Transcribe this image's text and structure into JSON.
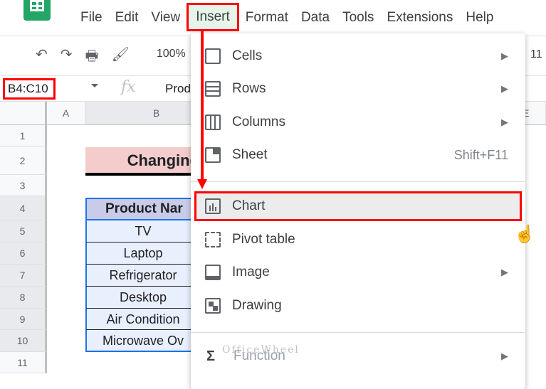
{
  "menubar": {
    "items": [
      "File",
      "Edit",
      "View",
      "Insert",
      "Format",
      "Data",
      "Tools",
      "Extensions",
      "Help"
    ]
  },
  "toolbar": {
    "zoom": "100%",
    "font_size": "11"
  },
  "formula_bar": {
    "name_box": "B4:C10",
    "fx": "fx",
    "content": "Prod"
  },
  "columns": [
    "A",
    "B",
    "E"
  ],
  "rows": [
    "1",
    "2",
    "3",
    "4",
    "5",
    "6",
    "7",
    "8",
    "9",
    "10",
    "11"
  ],
  "sheet": {
    "title": "Changing",
    "header": "Product Nar",
    "cells": [
      "TV",
      "Laptop",
      "Refrigerator",
      "Desktop",
      "Air Condition",
      "Microwave Ov"
    ]
  },
  "insert_menu": {
    "items": [
      {
        "label": "Cells",
        "icon": "cells-icon",
        "submenu": true
      },
      {
        "label": "Rows",
        "icon": "rows-icon",
        "submenu": true
      },
      {
        "label": "Columns",
        "icon": "columns-icon",
        "submenu": true
      },
      {
        "label": "Sheet",
        "icon": "sheet-icon",
        "shortcut": "Shift+F11"
      },
      {
        "label": "Chart",
        "icon": "chart-icon",
        "highlighted": true
      },
      {
        "label": "Pivot table",
        "icon": "pivot-table-icon"
      },
      {
        "label": "Image",
        "icon": "image-icon",
        "submenu": true
      },
      {
        "label": "Drawing",
        "icon": "drawing-icon"
      },
      {
        "label": "Function",
        "icon": "sigma-icon",
        "submenu": true
      }
    ]
  },
  "watermark": "OfficeWheel",
  "colors": {
    "highlight": "#ff0000",
    "title_fill": "#f4cccc",
    "header_fill": "#c9cbe8",
    "cell_fill": "#e8f0fe"
  }
}
